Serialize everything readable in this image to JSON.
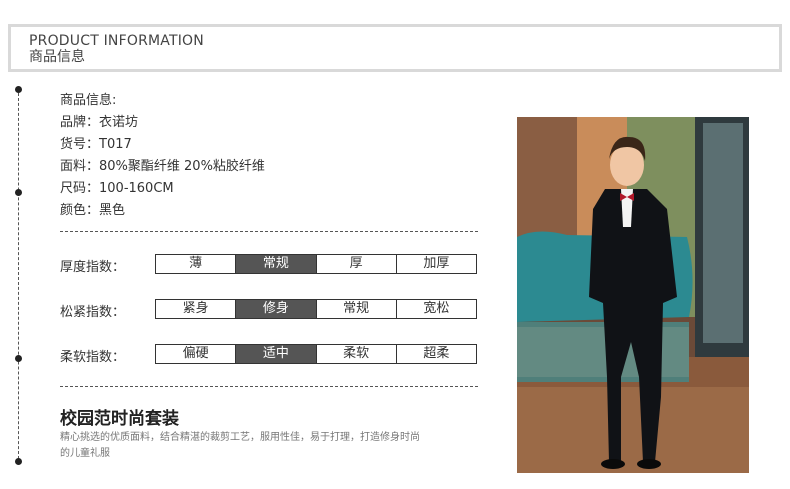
{
  "header": {
    "title_en": "PRODUCT INFORMATION",
    "title_cn": "商品信息"
  },
  "info": {
    "heading": "商品信息:",
    "lines": [
      "品牌：衣诺坊",
      "货号：T017",
      "面料：80%聚酯纤维 20%粘胶纤维",
      "尺码：100-160CM",
      "颜色：黑色"
    ]
  },
  "indices": [
    {
      "label": "厚度指数：",
      "options": [
        "薄",
        "常规",
        "厚",
        "加厚"
      ],
      "selected": 1
    },
    {
      "label": "松紧指数：",
      "options": [
        "紧身",
        "修身",
        "常规",
        "宽松"
      ],
      "selected": 1
    },
    {
      "label": "柔软指数：",
      "options": [
        "偏硬",
        "适中",
        "柔软",
        "超柔"
      ],
      "selected": 1
    }
  ],
  "tagline": {
    "title": "校园范时尚套装",
    "desc": "精心挑选的优质面料，结合精湛的裁剪工艺，服用性佳，易于打理，打造修身时尚的儿童礼服"
  },
  "colors": {
    "header_band": "#d9d9d9",
    "selected_cell": "#555555"
  }
}
